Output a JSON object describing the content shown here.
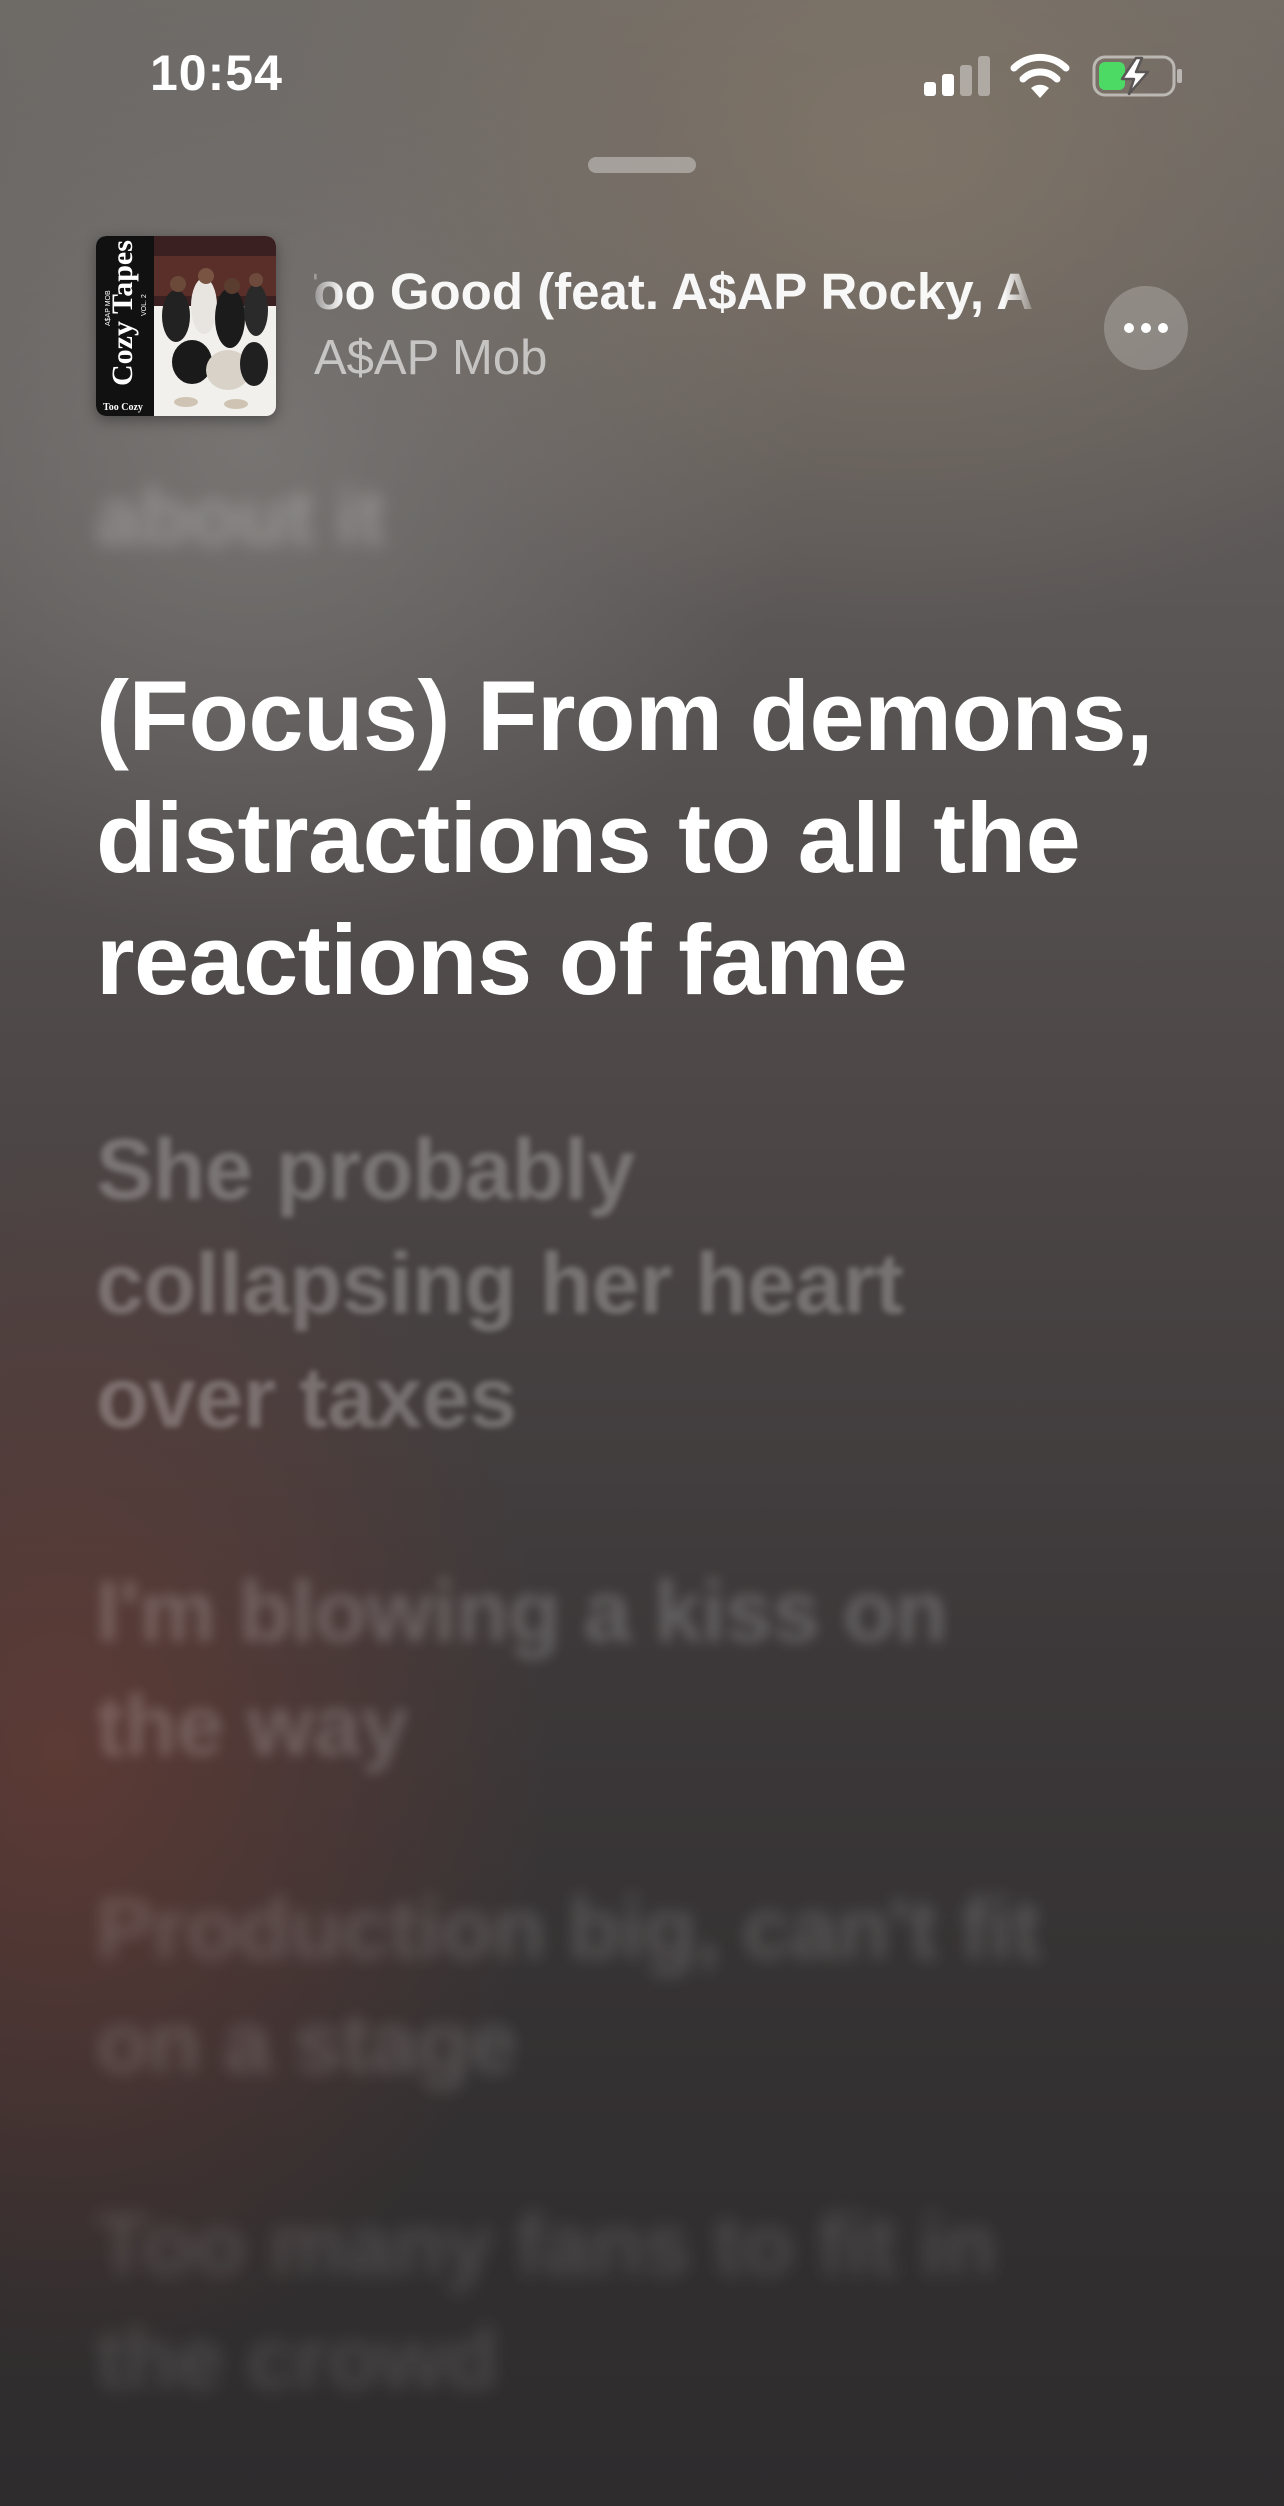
{
  "status_bar": {
    "time": "10:54",
    "icons": [
      "cellular-signal-icon",
      "wifi-icon",
      "battery-charging-icon"
    ],
    "battery_color": "#4cd964"
  },
  "now_playing": {
    "title": "Too Good (feat. A$AP Rocky, A$AP",
    "artist": "A$AP Mob",
    "artwork_text": {
      "brand": "A$AP MOB",
      "album": "Cozy Tapes",
      "volume": "VOL. 2",
      "caption": "Too Cozy"
    },
    "more_button_icon": "ellipsis-icon"
  },
  "lyrics": {
    "previous": "about it",
    "current": "(Focus) From demons, distractions to all the reactions of fame",
    "upcoming": [
      "She probably collapsing her heart over taxes",
      "I'm blowing a kiss on the way",
      "Production big, can't fit on a stage",
      "Too many fans to fit in the crowd"
    ]
  },
  "colors": {
    "text_primary": "#ffffff",
    "background_top": "#6e6a66",
    "background_bottom": "#2e2c2d"
  }
}
